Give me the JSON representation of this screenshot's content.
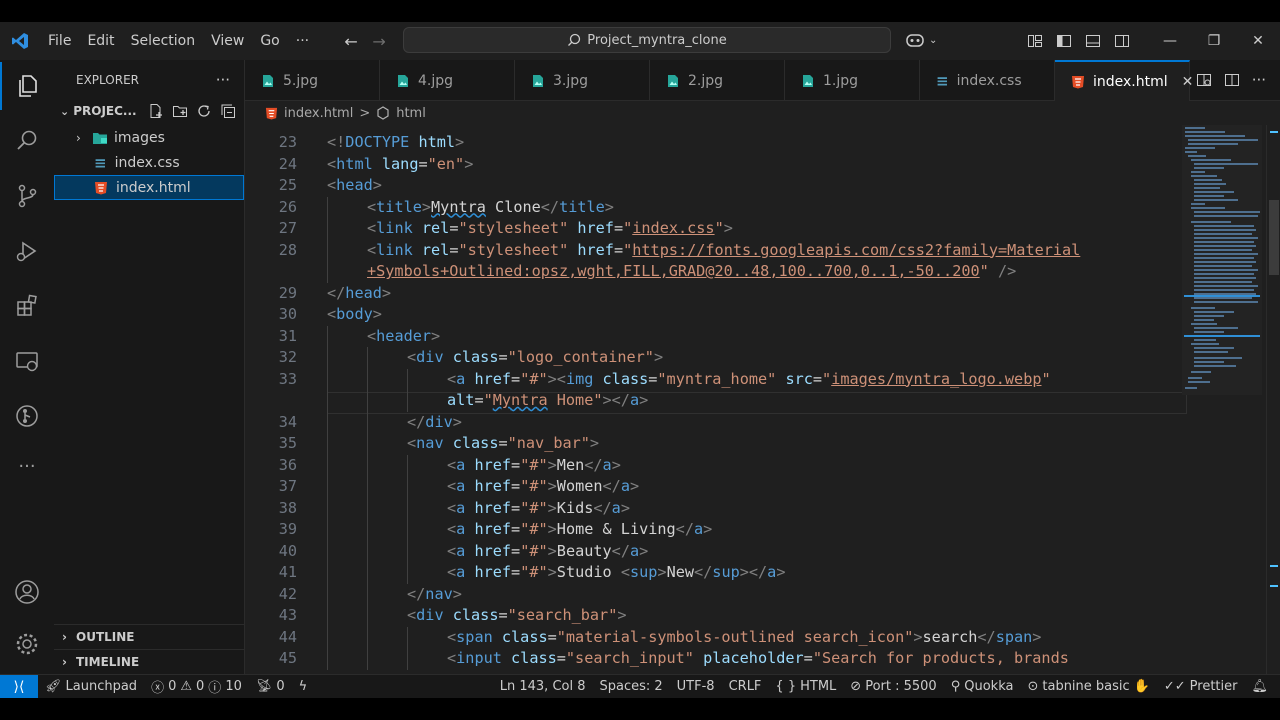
{
  "titlebar": {
    "menu": [
      "File",
      "Edit",
      "Selection",
      "View",
      "Go"
    ],
    "more": "···",
    "search": "Project_myntra_clone"
  },
  "explorer": {
    "title": "EXPLORER",
    "more": "···",
    "project": "PROJEC...",
    "tree": [
      {
        "label": "images",
        "kind": "folder"
      },
      {
        "label": "index.css",
        "kind": "css"
      },
      {
        "label": "index.html",
        "kind": "html",
        "selected": true
      }
    ],
    "outline": "OUTLINE",
    "timeline": "TIMELINE"
  },
  "tabs": [
    {
      "label": "5.jpg",
      "kind": "image"
    },
    {
      "label": "4.jpg",
      "kind": "image"
    },
    {
      "label": "3.jpg",
      "kind": "image"
    },
    {
      "label": "2.jpg",
      "kind": "image"
    },
    {
      "label": "1.jpg",
      "kind": "image"
    },
    {
      "label": "index.css",
      "kind": "css"
    },
    {
      "label": "index.html",
      "kind": "html",
      "active": true
    }
  ],
  "breadcrumb": {
    "file": "index.html",
    "sep": ">",
    "symbol": "html"
  },
  "editor": {
    "lines": [
      {
        "n": "23",
        "indent": 0,
        "t": [
          [
            "tg",
            "<!"
          ],
          [
            "tn",
            "DOCTYPE"
          ],
          [
            "tx",
            " "
          ],
          [
            "an",
            "html"
          ],
          [
            "tg",
            ">"
          ]
        ]
      },
      {
        "n": "24",
        "indent": 0,
        "t": [
          [
            "tg",
            "<"
          ],
          [
            "tn",
            "html"
          ],
          [
            "tx",
            " "
          ],
          [
            "an",
            "lang"
          ],
          [
            "tx",
            "="
          ],
          [
            "av",
            "\"en\""
          ],
          [
            "tg",
            ">"
          ]
        ]
      },
      {
        "n": "25",
        "indent": 0,
        "t": [
          [
            "tg",
            "<"
          ],
          [
            "tn",
            "head"
          ],
          [
            "tg",
            ">"
          ]
        ]
      },
      {
        "n": "26",
        "indent": 1,
        "t": [
          [
            "tg",
            "<"
          ],
          [
            "tn",
            "title"
          ],
          [
            "tg",
            ">"
          ],
          [
            "sq",
            "Myntra"
          ],
          [
            "tx",
            " Clone"
          ],
          [
            "tg",
            "</"
          ],
          [
            "tn",
            "title"
          ],
          [
            "tg",
            ">"
          ]
        ]
      },
      {
        "n": "27",
        "indent": 1,
        "t": [
          [
            "tg",
            "<"
          ],
          [
            "tn",
            "link"
          ],
          [
            "tx",
            " "
          ],
          [
            "an",
            "rel"
          ],
          [
            "tx",
            "="
          ],
          [
            "av",
            "\"stylesheet\""
          ],
          [
            "tx",
            " "
          ],
          [
            "an",
            "href"
          ],
          [
            "tx",
            "="
          ],
          [
            "av",
            "\""
          ],
          [
            "avl",
            "index.css"
          ],
          [
            "av",
            "\""
          ],
          [
            "tg",
            ">"
          ]
        ]
      },
      {
        "n": "28",
        "indent": 1,
        "t": [
          [
            "tg",
            "<"
          ],
          [
            "tn",
            "link"
          ],
          [
            "tx",
            " "
          ],
          [
            "an",
            "rel"
          ],
          [
            "tx",
            "="
          ],
          [
            "av",
            "\"stylesheet\""
          ],
          [
            "tx",
            " "
          ],
          [
            "an",
            "href"
          ],
          [
            "tx",
            "="
          ],
          [
            "av",
            "\""
          ],
          [
            "avl",
            "https://fonts.googleapis.com/css2?family=Material"
          ]
        ]
      },
      {
        "n": "",
        "indent": 1,
        "t": [
          [
            "avl",
            "+Symbols+Outlined:opsz,wght,FILL,GRAD@20..48,100..700,0..1,-50..200"
          ],
          [
            "av",
            "\""
          ],
          [
            "tx",
            " "
          ],
          [
            "tg",
            "/>"
          ]
        ]
      },
      {
        "n": "29",
        "indent": 0,
        "t": [
          [
            "tg",
            "</"
          ],
          [
            "tn",
            "head"
          ],
          [
            "tg",
            ">"
          ]
        ]
      },
      {
        "n": "30",
        "indent": 0,
        "t": [
          [
            "tg",
            "<"
          ],
          [
            "tn",
            "body"
          ],
          [
            "tg",
            ">"
          ]
        ]
      },
      {
        "n": "31",
        "indent": 1,
        "t": [
          [
            "tg",
            "<"
          ],
          [
            "tn",
            "header"
          ],
          [
            "tg",
            ">"
          ]
        ]
      },
      {
        "n": "32",
        "indent": 2,
        "t": [
          [
            "tg",
            "<"
          ],
          [
            "tn",
            "div"
          ],
          [
            "tx",
            " "
          ],
          [
            "an",
            "class"
          ],
          [
            "tx",
            "="
          ],
          [
            "av",
            "\"logo_container\""
          ],
          [
            "tg",
            ">"
          ]
        ]
      },
      {
        "n": "33",
        "indent": 3,
        "t": [
          [
            "tg",
            "<"
          ],
          [
            "tn",
            "a"
          ],
          [
            "tx",
            " "
          ],
          [
            "an",
            "href"
          ],
          [
            "tx",
            "="
          ],
          [
            "av",
            "\"#\""
          ],
          [
            "tg",
            "><"
          ],
          [
            "tn",
            "img"
          ],
          [
            "tx",
            " "
          ],
          [
            "an",
            "class"
          ],
          [
            "tx",
            "="
          ],
          [
            "av",
            "\"myntra_home\""
          ],
          [
            "tx",
            " "
          ],
          [
            "an",
            "src"
          ],
          [
            "tx",
            "="
          ],
          [
            "av",
            "\""
          ],
          [
            "avl",
            "images/myntra_logo.webp"
          ],
          [
            "av",
            "\""
          ]
        ]
      },
      {
        "n": "",
        "indent": 3,
        "t": [
          [
            "an",
            "alt"
          ],
          [
            "tx",
            "="
          ],
          [
            "av",
            "\""
          ],
          [
            "avs",
            "Myntra"
          ],
          [
            "av",
            " Home\""
          ],
          [
            "tg",
            "></"
          ],
          [
            "tn",
            "a"
          ],
          [
            "tg",
            ">"
          ]
        ]
      },
      {
        "n": "34",
        "indent": 2,
        "t": [
          [
            "tg",
            "</"
          ],
          [
            "tn",
            "div"
          ],
          [
            "tg",
            ">"
          ]
        ]
      },
      {
        "n": "35",
        "indent": 2,
        "t": [
          [
            "tg",
            "<"
          ],
          [
            "tn",
            "nav"
          ],
          [
            "tx",
            " "
          ],
          [
            "an",
            "class"
          ],
          [
            "tx",
            "="
          ],
          [
            "av",
            "\"nav_bar\""
          ],
          [
            "tg",
            ">"
          ]
        ]
      },
      {
        "n": "36",
        "indent": 3,
        "t": [
          [
            "tg",
            "<"
          ],
          [
            "tn",
            "a"
          ],
          [
            "tx",
            " "
          ],
          [
            "an",
            "href"
          ],
          [
            "tx",
            "="
          ],
          [
            "av",
            "\"#\""
          ],
          [
            "tg",
            ">"
          ],
          [
            "tx",
            "Men"
          ],
          [
            "tg",
            "</"
          ],
          [
            "tn",
            "a"
          ],
          [
            "tg",
            ">"
          ]
        ]
      },
      {
        "n": "37",
        "indent": 3,
        "t": [
          [
            "tg",
            "<"
          ],
          [
            "tn",
            "a"
          ],
          [
            "tx",
            " "
          ],
          [
            "an",
            "href"
          ],
          [
            "tx",
            "="
          ],
          [
            "av",
            "\"#\""
          ],
          [
            "tg",
            ">"
          ],
          [
            "tx",
            "Women"
          ],
          [
            "tg",
            "</"
          ],
          [
            "tn",
            "a"
          ],
          [
            "tg",
            ">"
          ]
        ]
      },
      {
        "n": "38",
        "indent": 3,
        "t": [
          [
            "tg",
            "<"
          ],
          [
            "tn",
            "a"
          ],
          [
            "tx",
            " "
          ],
          [
            "an",
            "href"
          ],
          [
            "tx",
            "="
          ],
          [
            "av",
            "\"#\""
          ],
          [
            "tg",
            ">"
          ],
          [
            "tx",
            "Kids"
          ],
          [
            "tg",
            "</"
          ],
          [
            "tn",
            "a"
          ],
          [
            "tg",
            ">"
          ]
        ]
      },
      {
        "n": "39",
        "indent": 3,
        "t": [
          [
            "tg",
            "<"
          ],
          [
            "tn",
            "a"
          ],
          [
            "tx",
            " "
          ],
          [
            "an",
            "href"
          ],
          [
            "tx",
            "="
          ],
          [
            "av",
            "\"#\""
          ],
          [
            "tg",
            ">"
          ],
          [
            "tx",
            "Home & Living"
          ],
          [
            "tg",
            "</"
          ],
          [
            "tn",
            "a"
          ],
          [
            "tg",
            ">"
          ]
        ]
      },
      {
        "n": "40",
        "indent": 3,
        "t": [
          [
            "tg",
            "<"
          ],
          [
            "tn",
            "a"
          ],
          [
            "tx",
            " "
          ],
          [
            "an",
            "href"
          ],
          [
            "tx",
            "="
          ],
          [
            "av",
            "\"#\""
          ],
          [
            "tg",
            ">"
          ],
          [
            "tx",
            "Beauty"
          ],
          [
            "tg",
            "</"
          ],
          [
            "tn",
            "a"
          ],
          [
            "tg",
            ">"
          ]
        ]
      },
      {
        "n": "41",
        "indent": 3,
        "t": [
          [
            "tg",
            "<"
          ],
          [
            "tn",
            "a"
          ],
          [
            "tx",
            " "
          ],
          [
            "an",
            "href"
          ],
          [
            "tx",
            "="
          ],
          [
            "av",
            "\"#\""
          ],
          [
            "tg",
            ">"
          ],
          [
            "tx",
            "Studio "
          ],
          [
            "tg",
            "<"
          ],
          [
            "tn",
            "sup"
          ],
          [
            "tg",
            ">"
          ],
          [
            "tx",
            "New"
          ],
          [
            "tg",
            "</"
          ],
          [
            "tn",
            "sup"
          ],
          [
            "tg",
            "></"
          ],
          [
            "tn",
            "a"
          ],
          [
            "tg",
            ">"
          ]
        ]
      },
      {
        "n": "42",
        "indent": 2,
        "t": [
          [
            "tg",
            "</"
          ],
          [
            "tn",
            "nav"
          ],
          [
            "tg",
            ">"
          ]
        ]
      },
      {
        "n": "43",
        "indent": 2,
        "t": [
          [
            "tg",
            "<"
          ],
          [
            "tn",
            "div"
          ],
          [
            "tx",
            " "
          ],
          [
            "an",
            "class"
          ],
          [
            "tx",
            "="
          ],
          [
            "av",
            "\"search_bar\""
          ],
          [
            "tg",
            ">"
          ]
        ]
      },
      {
        "n": "44",
        "indent": 3,
        "t": [
          [
            "tg",
            "<"
          ],
          [
            "tn",
            "span"
          ],
          [
            "tx",
            " "
          ],
          [
            "an",
            "class"
          ],
          [
            "tx",
            "="
          ],
          [
            "av",
            "\"material-symbols-outlined search_icon\""
          ],
          [
            "tg",
            ">"
          ],
          [
            "tx",
            "search"
          ],
          [
            "tg",
            "</"
          ],
          [
            "tn",
            "span"
          ],
          [
            "tg",
            ">"
          ]
        ]
      },
      {
        "n": "45",
        "indent": 3,
        "t": [
          [
            "tg",
            "<"
          ],
          [
            "tn",
            "input"
          ],
          [
            "tx",
            " "
          ],
          [
            "an",
            "class"
          ],
          [
            "tx",
            "="
          ],
          [
            "av",
            "\"search_input\""
          ],
          [
            "tx",
            " "
          ],
          [
            "an",
            "placeholder"
          ],
          [
            "tx",
            "="
          ],
          [
            "av",
            "\"Search for products, brands"
          ]
        ]
      }
    ]
  },
  "statusbar": {
    "launchpad": "Launchpad",
    "errors": "0",
    "warnings": "0",
    "info": "10",
    "ports": "0",
    "position": "Ln 143, Col 8",
    "spaces": "Spaces: 2",
    "encoding": "UTF-8",
    "eol": "CRLF",
    "language": "HTML",
    "port": "Port : 5500",
    "quokka": "Quokka",
    "tabnine": "tabnine basic",
    "prettier": "Prettier"
  },
  "colors": {
    "accent": "#0078d4",
    "tag": "#569cd6",
    "attr": "#9cdcfe",
    "string": "#ce9178",
    "html_icon": "#e44d26",
    "css_icon": "#519aba",
    "image_icon": "#26a69a"
  },
  "icons": {
    "activity": [
      "explorer-icon",
      "search-icon",
      "source-control-icon",
      "run-debug-icon",
      "extensions-icon",
      "remote-explorer-icon",
      "gitlens-icon",
      "more-icon",
      "account-icon",
      "settings-gear-icon"
    ]
  }
}
